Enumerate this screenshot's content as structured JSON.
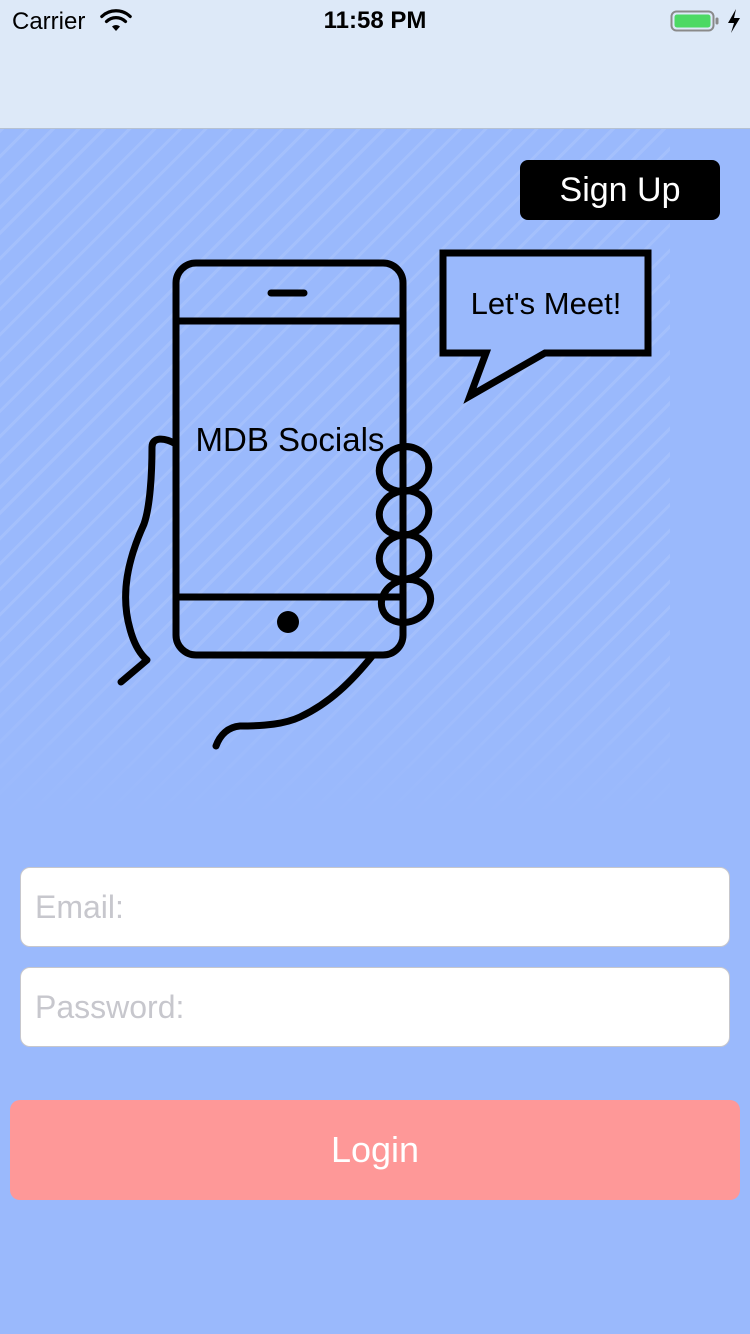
{
  "status_bar": {
    "carrier": "Carrier",
    "time": "11:58 PM",
    "battery_color": "#4cd964"
  },
  "header": {
    "signup_label": "Sign Up"
  },
  "illustration": {
    "phone_label": "MDB Socials",
    "bubble_text": "Let's Meet!",
    "icons": [
      "hand-holding-phone-icon",
      "speech-bubble-icon"
    ]
  },
  "form": {
    "email_placeholder": "Email:",
    "email_value": "",
    "password_placeholder": "Password:",
    "password_value": "",
    "login_label": "Login"
  },
  "colors": {
    "background": "#9ab9fc",
    "bar": "#dde9f8",
    "signup_bg": "#000000",
    "login_bg": "#fe9898"
  }
}
